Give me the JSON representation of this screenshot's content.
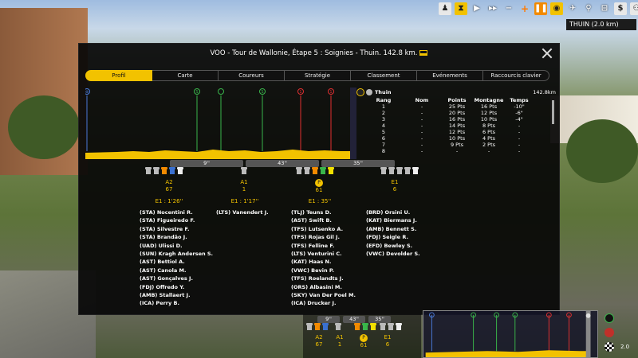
{
  "toolbar": {
    "speed_icons": [
      "play-icon",
      "fast-forward-icon",
      "minus-icon",
      "plus-icon",
      "pause-icon"
    ],
    "location_label": "THUIN (2.0 km)"
  },
  "modal": {
    "title": "VOO - Tour de Wallonie, Étape 5 : Soignies - Thuin. 142.8 km.",
    "tabs": [
      "Profil",
      "Carte",
      "Coureurs",
      "Stratégie",
      "Classement",
      "Evénements",
      "Raccourcis clavier"
    ],
    "active_tab": "Profil"
  },
  "finish": {
    "name": "Thuin",
    "distance": "142.8km",
    "headers": [
      "Rang",
      "Nom",
      "Points",
      "Montagne",
      "Temps"
    ],
    "rows": [
      [
        "1",
        "-",
        "25 Pts",
        "16 Pts",
        "-10\""
      ],
      [
        "2",
        "-",
        "20 Pts",
        "12 Pts",
        "-6\""
      ],
      [
        "3",
        "-",
        "16 Pts",
        "10 Pts",
        "-4\""
      ],
      [
        "4",
        "-",
        "14 Pts",
        "8 Pts",
        "-"
      ],
      [
        "5",
        "-",
        "12 Pts",
        "6 Pts",
        "-"
      ],
      [
        "6",
        "-",
        "10 Pts",
        "4 Pts",
        "-"
      ],
      [
        "7",
        "-",
        "9 Pts",
        "2 Pts",
        "-"
      ],
      [
        "8",
        "-",
        "-",
        "-",
        "-"
      ]
    ]
  },
  "gaps": [
    "9''",
    "43''",
    "35''"
  ],
  "groups": [
    {
      "label": "A2",
      "count": "67",
      "time": "E1 : 1'26''",
      "riders": [
        "(STA) Nocentini R.",
        "(STA) Figueiredo F.",
        "(STA) Silvestre F.",
        "(STA) Brandão J.",
        "(UAD) Ulissi D.",
        "(SUN) Kragh Andersen S.",
        "(AST) Bettiol A.",
        "(AST) Canola M.",
        "(AST) Gonçalves J.",
        "(FDJ) Offredo Y.",
        "(AMB) Stallaert J.",
        "(ICA) Perry B."
      ]
    },
    {
      "label": "A1",
      "count": "1",
      "time": "E1 : 1'17''",
      "riders": [
        "(LTS) Vanendert J."
      ]
    },
    {
      "label": "P",
      "count": "61",
      "time": "E1 : 35''",
      "riders": [
        "(TLJ) Teuns D.",
        "(AST) Swift B.",
        "(TFS) Lutsenko A.",
        "(TFS) Rojas Gil J.",
        "(TFS) Felline F.",
        "(LTS) Venturini C.",
        "(KAT) Haas N.",
        "(VWC) Bevin P.",
        "(TFS) Roelandts J.",
        "(ORS) Albasini M.",
        "(SKY) Van Der Poel M.",
        "(ICA) Drucker J."
      ]
    },
    {
      "label": "E1",
      "count": "6",
      "time": "",
      "riders": [
        "(BRD) Orsini U.",
        "(KAT) Biermans J.",
        "(AMB) Bennett S.",
        "(FDJ) Seigle R.",
        "(EFD) Bewley S.",
        "(VWC) Devolder S."
      ]
    }
  ],
  "profile_markers": [
    {
      "type": "start",
      "color": "#4a7ad8",
      "label": "⊕"
    },
    {
      "type": "sprint",
      "color": "#39b54a",
      "label": "S"
    },
    {
      "type": "sprint",
      "color": "#39b54a",
      "label": ""
    },
    {
      "type": "sprint",
      "color": "#39b54a",
      "label": "S"
    },
    {
      "type": "climb",
      "color": "#e03030",
      "label": "1"
    },
    {
      "type": "climb",
      "color": "#e03030",
      "label": "1"
    }
  ],
  "mini": {
    "gaps": [
      "9''",
      "43''",
      "35''"
    ],
    "groups": [
      [
        "A2",
        "67"
      ],
      [
        "A1",
        "1"
      ],
      [
        "P",
        "61"
      ],
      [
        "E1",
        "6"
      ]
    ],
    "speed": "2.0"
  }
}
